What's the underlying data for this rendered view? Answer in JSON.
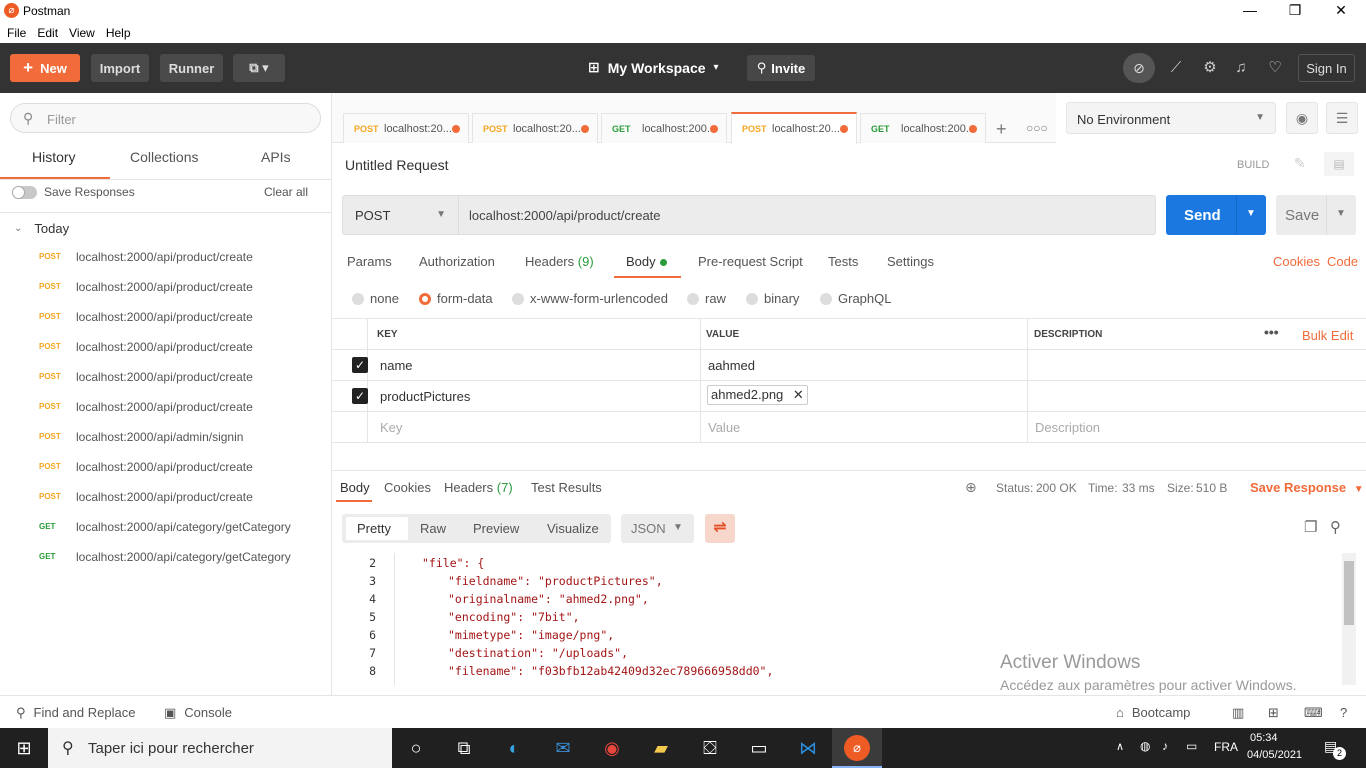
{
  "window": {
    "title": "Postman",
    "menu": [
      "File",
      "Edit",
      "View",
      "Help"
    ]
  },
  "header": {
    "new_label": "New",
    "import_label": "Import",
    "runner_label": "Runner",
    "workspace_label": "My Workspace",
    "invite_label": "Invite",
    "signin_label": "Sign In"
  },
  "sidebar": {
    "filter_placeholder": "Filter",
    "tabs": [
      "History",
      "Collections",
      "APIs"
    ],
    "save_responses": "Save Responses",
    "clear_all": "Clear all",
    "group": "Today",
    "items": [
      {
        "method": "POST",
        "url": "localhost:2000/api/product/create"
      },
      {
        "method": "POST",
        "url": "localhost:2000/api/product/create"
      },
      {
        "method": "POST",
        "url": "localhost:2000/api/product/create"
      },
      {
        "method": "POST",
        "url": "localhost:2000/api/product/create"
      },
      {
        "method": "POST",
        "url": "localhost:2000/api/product/create"
      },
      {
        "method": "POST",
        "url": "localhost:2000/api/product/create"
      },
      {
        "method": "POST",
        "url": "localhost:2000/api/admin/signin"
      },
      {
        "method": "POST",
        "url": "localhost:2000/api/product/create"
      },
      {
        "method": "POST",
        "url": "localhost:2000/api/product/create"
      },
      {
        "method": "GET",
        "url": "localhost:2000/api/category/getCategory"
      },
      {
        "method": "GET",
        "url": "localhost:2000/api/category/getCategory"
      }
    ]
  },
  "request_tabs": [
    {
      "method": "POST",
      "url": "localhost:20..."
    },
    {
      "method": "POST",
      "url": "localhost:20..."
    },
    {
      "method": "GET",
      "url": "localhost:200..."
    },
    {
      "method": "POST",
      "url": "localhost:20..."
    },
    {
      "method": "GET",
      "url": "localhost:200..."
    }
  ],
  "environment": {
    "selected": "No Environment"
  },
  "request": {
    "name": "Untitled Request",
    "build_label": "BUILD",
    "method": "POST",
    "url": "localhost:2000/api/product/create",
    "send_label": "Send",
    "save_label": "Save",
    "subtabs": {
      "params": "Params",
      "authorization": "Authorization",
      "headers": "Headers",
      "headers_count": "(9)",
      "body": "Body",
      "prerequest": "Pre-request Script",
      "tests": "Tests",
      "settings": "Settings"
    },
    "cookies_link": "Cookies",
    "code_link": "Code",
    "body_modes": [
      "none",
      "form-data",
      "x-www-form-urlencoded",
      "raw",
      "binary",
      "GraphQL"
    ],
    "table": {
      "headers": {
        "key": "KEY",
        "value": "VALUE",
        "description": "DESCRIPTION",
        "bulk_edit": "Bulk Edit"
      },
      "rows": [
        {
          "key": "name",
          "value": "aahmed"
        },
        {
          "key": "productPictures",
          "value": "ahmed2.png"
        }
      ],
      "placeholders": {
        "key": "Key",
        "value": "Value",
        "description": "Description"
      }
    }
  },
  "response": {
    "tabs": {
      "body": "Body",
      "cookies": "Cookies",
      "headers": "Headers",
      "headers_count": "(7)",
      "tests": "Test Results"
    },
    "status_label": "Status:",
    "status_value": "200 OK",
    "time_label": "Time:",
    "time_value": "33 ms",
    "size_label": "Size:",
    "size_value": "510 B",
    "save_response": "Save Response",
    "views": [
      "Pretty",
      "Raw",
      "Preview",
      "Visualize"
    ],
    "language": "JSON",
    "code_lines": [
      {
        "n": "2",
        "text": "\"file\": {"
      },
      {
        "n": "3",
        "text": "\"fieldname\": \"productPictures\","
      },
      {
        "n": "4",
        "text": "\"originalname\": \"ahmed2.png\","
      },
      {
        "n": "5",
        "text": "\"encoding\": \"7bit\","
      },
      {
        "n": "6",
        "text": "\"mimetype\": \"image/png\","
      },
      {
        "n": "7",
        "text": "\"destination\": \"/uploads\","
      },
      {
        "n": "8",
        "text": "\"filename\": \"f03bfb12ab42409d32ec789666958dd0\","
      }
    ]
  },
  "watermark": {
    "line1": "Activer Windows",
    "line2": "Accédez aux paramètres pour activer Windows."
  },
  "footer": {
    "find_replace": "Find and Replace",
    "console": "Console",
    "bootcamp": "Bootcamp"
  },
  "taskbar": {
    "search_placeholder": "Taper ici pour rechercher",
    "lang": "FRA",
    "time": "05:34",
    "date": "04/05/2021",
    "notif_count": "2"
  }
}
